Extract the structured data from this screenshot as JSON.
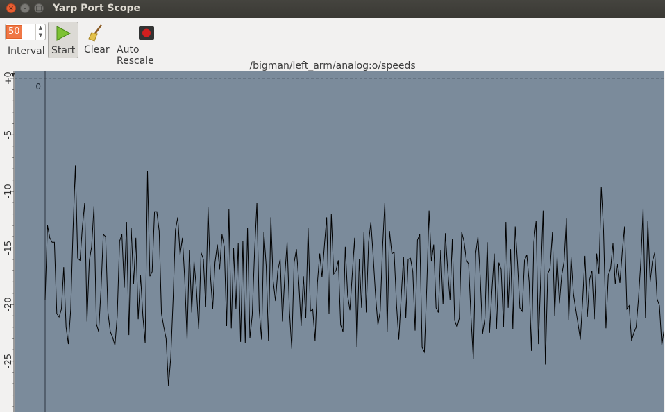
{
  "window": {
    "title": "Yarp Port Scope"
  },
  "toolbar": {
    "interval_value": "50",
    "interval_label": "Interval",
    "start_label": "Start",
    "clear_label": "Clear",
    "rescale_label": "Auto Rescale"
  },
  "icons": {
    "start": "play-icon",
    "clear": "broom-icon",
    "rescale": "record-icon"
  },
  "colors": {
    "plot_background": "#7b8b9b",
    "trace": "#000000",
    "start_icon": "#7dc232",
    "rescale_icon": "#d11f1f"
  },
  "chart_data": {
    "type": "line",
    "title": "/bigman/left_arm/analog:o/speeds",
    "xlabel": "",
    "ylabel": "",
    "ylim": [
      -29.5,
      0.6
    ],
    "xlim": [
      0,
      264
    ],
    "yticks": [
      {
        "value": 0,
        "label": "+0"
      },
      {
        "value": -5,
        "label": "-5"
      },
      {
        "value": -10,
        "label": "-10"
      },
      {
        "value": -15,
        "label": "-15"
      },
      {
        "value": -20,
        "label": "-20"
      },
      {
        "value": -25,
        "label": "-25"
      }
    ],
    "xticks": [
      {
        "value": 0,
        "label": "0"
      }
    ],
    "reference_line": 0,
    "grid": false,
    "series": [
      {
        "values": [
          -19.6,
          -13.0,
          -14.1,
          -14.5,
          -14.5,
          -20.8,
          -21.1,
          -20.4,
          -16.7,
          -22.0,
          -23.5,
          -20.4,
          -13.4,
          -7.7,
          -15.9,
          -16.1,
          -13.2,
          -11.0,
          -21.5,
          -16.1,
          -14.9,
          -11.3,
          -21.7,
          -22.4,
          -18.7,
          -13.8,
          -14.0,
          -20.7,
          -22.4,
          -22.9,
          -23.6,
          -21.0,
          -14.4,
          -13.8,
          -18.5,
          -12.7,
          -22.7,
          -13.2,
          -18.2,
          -14.1,
          -21.3,
          -17.4,
          -21.0,
          -23.4,
          -8.2,
          -17.5,
          -17.1,
          -11.8,
          -11.8,
          -13.5,
          -20.8,
          -22.0,
          -23.0,
          -27.2,
          -24.7,
          -19.5,
          -13.4,
          -12.3,
          -15.6,
          -14.1,
          -17.7,
          -23.1,
          -15.2,
          -20.7,
          -16.2,
          -18.6,
          -22.2,
          -15.4,
          -16.0,
          -20.2,
          -11.4,
          -17.3,
          -20.4,
          -16.3,
          -14.7,
          -16.9,
          -13.8,
          -14.9,
          -21.9,
          -11.6,
          -22.1,
          -15.0,
          -20.4,
          -14.6,
          -23.3,
          -14.4,
          -23.4,
          -13.2,
          -23.0,
          -20.9,
          -15.4,
          -11.0,
          -20.5,
          -23.1,
          -13.6,
          -16.6,
          -23.2,
          -12.3,
          -17.9,
          -19.7,
          -17.0,
          -16.0,
          -21.5,
          -17.4,
          -14.5,
          -20.6,
          -23.9,
          -16.3,
          -15.1,
          -18.0,
          -21.9,
          -17.5,
          -21.2,
          -13.2,
          -20.6,
          -20.4,
          -23.2,
          -18.1,
          -15.5,
          -17.6,
          -14.8,
          -12.3,
          -20.8,
          -12.0,
          -17.3,
          -17.0,
          -16.1,
          -21.8,
          -22.4,
          -14.9,
          -19.2,
          -20.5,
          -17.3,
          -14.1,
          -23.8,
          -16.0,
          -20.3,
          -13.6,
          -20.7,
          -14.5,
          -12.7,
          -15.8,
          -19.2,
          -21.8,
          -20.6,
          -15.0,
          -11.0,
          -22.4,
          -13.5,
          -15.5,
          -15.4,
          -20.0,
          -23.1,
          -19.4,
          -15.8,
          -21.2,
          -16.0,
          -15.9,
          -17.1,
          -22.3,
          -14.3,
          -13.8,
          -23.8,
          -24.2,
          -18.4,
          -11.7,
          -16.2,
          -14.7,
          -20.3,
          -20.7,
          -15.2,
          -20.0,
          -13.7,
          -16.9,
          -19.6,
          -14.2,
          -21.4,
          -22.0,
          -21.2,
          -13.6,
          -14.4,
          -16.1,
          -16.4,
          -21.1,
          -24.8,
          -15.5,
          -14.0,
          -17.7,
          -22.6,
          -21.2,
          -14.5,
          -22.5,
          -18.8,
          -15.5,
          -22.2,
          -16.3,
          -16.9,
          -22.0,
          -12.7,
          -20.3,
          -15.1,
          -22.2,
          -13.1,
          -16.3,
          -20.3,
          -20.6,
          -16.1,
          -15.6,
          -18.0,
          -24.1,
          -14.5,
          -12.6,
          -23.5,
          -17.6,
          -11.7,
          -25.3,
          -17.3,
          -16.8,
          -13.6,
          -21.0,
          -15.8,
          -19.9,
          -17.4,
          -16.2,
          -12.4,
          -21.4,
          -15.8,
          -19.0,
          -20.4,
          -21.7,
          -23.1,
          -19.6,
          -15.7,
          -21.1,
          -17.8,
          -17.0,
          -21.3,
          -15.5,
          -17.3,
          -9.6,
          -13.5,
          -22.1,
          -17.4,
          -16.8,
          -14.6,
          -18.2,
          -16.4,
          -18.1,
          -15.3,
          -13.1,
          -20.4,
          -20.1,
          -23.2,
          -22.5,
          -22.0,
          -19.5,
          -16.2,
          -11.5,
          -21.2,
          -12.6,
          -18.0,
          -16.2,
          -15.4,
          -19.5,
          -20.1,
          -23.6,
          -22.2,
          -19.1,
          -16.0,
          -16.2,
          -17.0,
          -21.3,
          -20.9,
          -18.4,
          -13.1,
          -14.3,
          -16.7,
          -16.2,
          -15.2,
          -22.4,
          -20.6,
          -17.2,
          -15.4,
          -24.0,
          -29.0,
          -23.4,
          -16.0,
          -16.3,
          -21.1,
          -24.4,
          -16.3,
          -15.7,
          -22.8,
          -21.4,
          -18.0,
          -22.3,
          -15.3,
          -25.3,
          -21.7,
          -17.9,
          -14.6,
          -17.5,
          -20.4,
          -14.8,
          -19.3,
          -18.3,
          -12.7,
          -20.3,
          -17.2,
          -16.1,
          -14.1,
          -24.2,
          -17.0,
          -27.5,
          -16.5,
          -13.3,
          -21.0,
          -18.2,
          -13.0,
          -11.7,
          -20.8,
          -14.6,
          -21.3,
          -22.2,
          -11.2,
          -16.0,
          -17.6,
          -12.5,
          -20.5,
          -20.4,
          -22.3,
          -16.7,
          -15.4,
          -12.9,
          -13.6,
          -19.5,
          -15.9,
          -24.3,
          -21.7,
          -20.6,
          -22.2,
          -19.7,
          -16.4,
          -15.4,
          -18.1,
          -9.4,
          -13.6,
          -19.0,
          -15.4,
          -14.7,
          -15.0,
          -14.2,
          -18.0,
          -13.9,
          -20.7,
          -13.8,
          -17.0,
          -20.0,
          -19.6,
          -12.8,
          -16.5,
          -21.0,
          -15.5,
          -18.9,
          -25.2,
          -18.8,
          -17.1,
          -12.1,
          -16.3
        ]
      }
    ]
  }
}
